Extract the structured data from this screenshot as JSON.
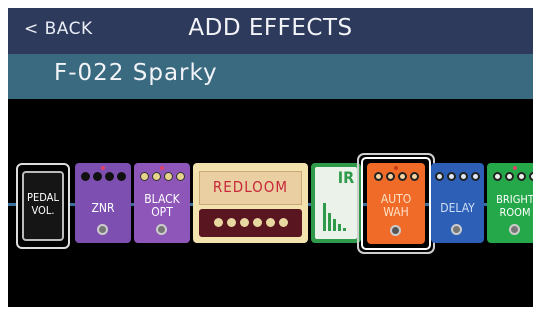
{
  "header": {
    "back_label": "< BACK",
    "title": "ADD EFFECTS"
  },
  "patch": {
    "name": "F-022 Sparky"
  },
  "pedals": {
    "pedal_vol": {
      "label": "PEDAL\nVOL."
    },
    "znr": {
      "label": "ZNR",
      "color": "#7d4fb0"
    },
    "black_opt": {
      "label": "BLACK\nOPT",
      "color": "#8d56b8"
    },
    "redloom": {
      "label": "REDLOOM",
      "color": "#f1e2ae"
    },
    "ir": {
      "label": "IR",
      "color": "#2f9a4a"
    },
    "auto_wah": {
      "label": "AUTO\nWAH",
      "color": "#f06a28"
    },
    "delay": {
      "label": "DELAY",
      "color": "#2c5fb5"
    },
    "bright_room": {
      "label": "BRIGHT\nROOM",
      "color": "#25a84a"
    }
  },
  "selected": "auto_wah"
}
